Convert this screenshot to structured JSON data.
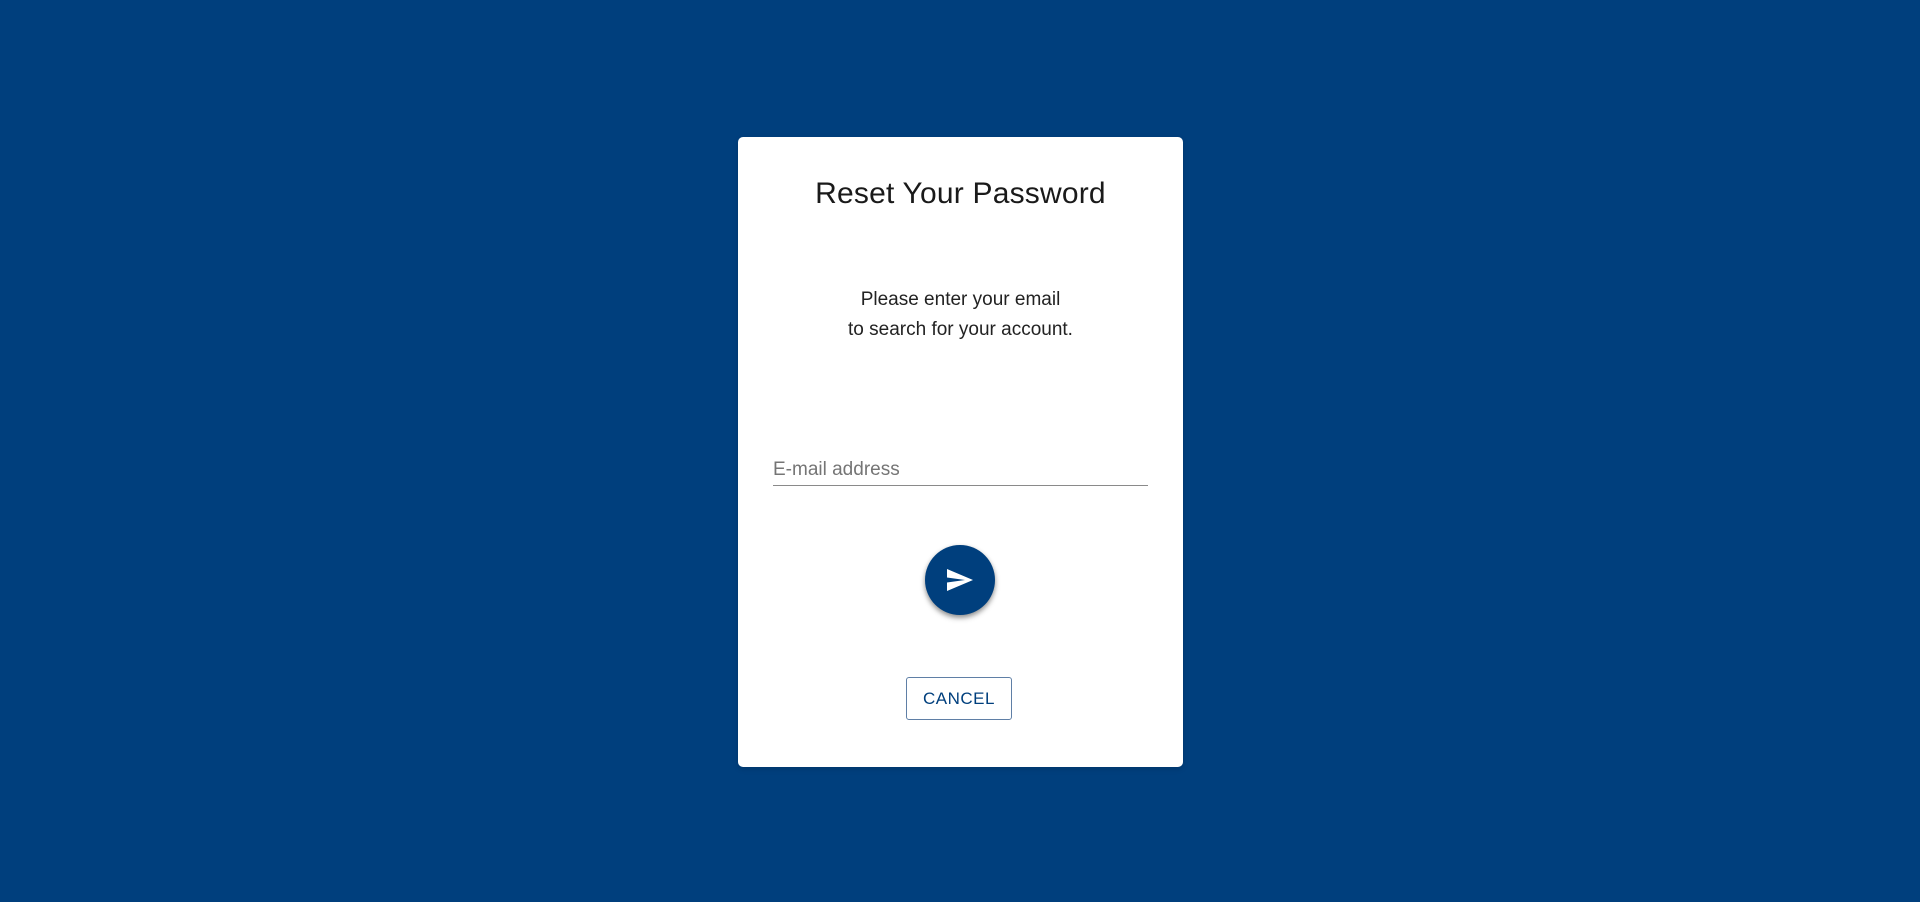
{
  "colors": {
    "background": "#003f7d",
    "card": "#ffffff",
    "accent": "#003f7d"
  },
  "dialog": {
    "title": "Reset Your Password",
    "instructions": {
      "line1": "Please enter your email",
      "line2": "to search for your account."
    },
    "email": {
      "placeholder": "E-mail address",
      "value": ""
    },
    "submit": {
      "icon": "send-icon"
    },
    "cancel_label": "CANCEL"
  }
}
